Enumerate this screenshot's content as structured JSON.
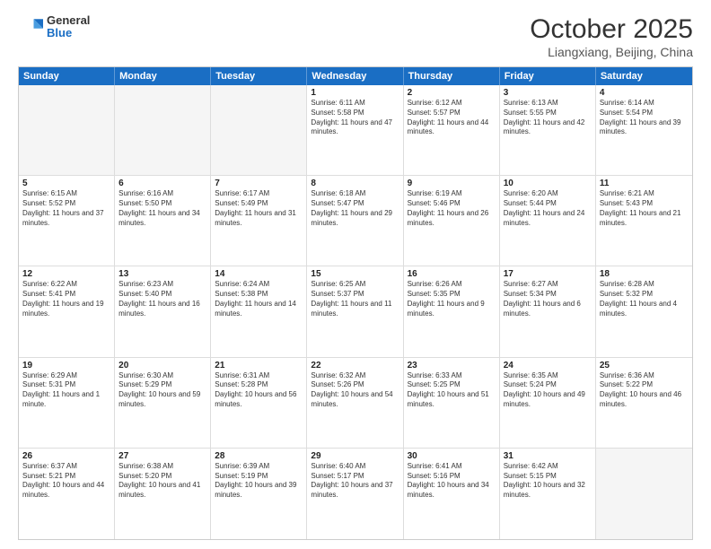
{
  "header": {
    "logo_general": "General",
    "logo_blue": "Blue",
    "month_title": "October 2025",
    "location": "Liangxiang, Beijing, China"
  },
  "days": [
    "Sunday",
    "Monday",
    "Tuesday",
    "Wednesday",
    "Thursday",
    "Friday",
    "Saturday"
  ],
  "rows": [
    [
      {
        "day": "",
        "empty": true
      },
      {
        "day": "",
        "empty": true
      },
      {
        "day": "",
        "empty": true
      },
      {
        "day": "1",
        "sunrise": "6:11 AM",
        "sunset": "5:58 PM",
        "daylight": "11 hours and 47 minutes."
      },
      {
        "day": "2",
        "sunrise": "6:12 AM",
        "sunset": "5:57 PM",
        "daylight": "11 hours and 44 minutes."
      },
      {
        "day": "3",
        "sunrise": "6:13 AM",
        "sunset": "5:55 PM",
        "daylight": "11 hours and 42 minutes."
      },
      {
        "day": "4",
        "sunrise": "6:14 AM",
        "sunset": "5:54 PM",
        "daylight": "11 hours and 39 minutes."
      }
    ],
    [
      {
        "day": "5",
        "sunrise": "6:15 AM",
        "sunset": "5:52 PM",
        "daylight": "11 hours and 37 minutes."
      },
      {
        "day": "6",
        "sunrise": "6:16 AM",
        "sunset": "5:50 PM",
        "daylight": "11 hours and 34 minutes."
      },
      {
        "day": "7",
        "sunrise": "6:17 AM",
        "sunset": "5:49 PM",
        "daylight": "11 hours and 31 minutes."
      },
      {
        "day": "8",
        "sunrise": "6:18 AM",
        "sunset": "5:47 PM",
        "daylight": "11 hours and 29 minutes."
      },
      {
        "day": "9",
        "sunrise": "6:19 AM",
        "sunset": "5:46 PM",
        "daylight": "11 hours and 26 minutes."
      },
      {
        "day": "10",
        "sunrise": "6:20 AM",
        "sunset": "5:44 PM",
        "daylight": "11 hours and 24 minutes."
      },
      {
        "day": "11",
        "sunrise": "6:21 AM",
        "sunset": "5:43 PM",
        "daylight": "11 hours and 21 minutes."
      }
    ],
    [
      {
        "day": "12",
        "sunrise": "6:22 AM",
        "sunset": "5:41 PM",
        "daylight": "11 hours and 19 minutes."
      },
      {
        "day": "13",
        "sunrise": "6:23 AM",
        "sunset": "5:40 PM",
        "daylight": "11 hours and 16 minutes."
      },
      {
        "day": "14",
        "sunrise": "6:24 AM",
        "sunset": "5:38 PM",
        "daylight": "11 hours and 14 minutes."
      },
      {
        "day": "15",
        "sunrise": "6:25 AM",
        "sunset": "5:37 PM",
        "daylight": "11 hours and 11 minutes."
      },
      {
        "day": "16",
        "sunrise": "6:26 AM",
        "sunset": "5:35 PM",
        "daylight": "11 hours and 9 minutes."
      },
      {
        "day": "17",
        "sunrise": "6:27 AM",
        "sunset": "5:34 PM",
        "daylight": "11 hours and 6 minutes."
      },
      {
        "day": "18",
        "sunrise": "6:28 AM",
        "sunset": "5:32 PM",
        "daylight": "11 hours and 4 minutes."
      }
    ],
    [
      {
        "day": "19",
        "sunrise": "6:29 AM",
        "sunset": "5:31 PM",
        "daylight": "11 hours and 1 minute."
      },
      {
        "day": "20",
        "sunrise": "6:30 AM",
        "sunset": "5:29 PM",
        "daylight": "10 hours and 59 minutes."
      },
      {
        "day": "21",
        "sunrise": "6:31 AM",
        "sunset": "5:28 PM",
        "daylight": "10 hours and 56 minutes."
      },
      {
        "day": "22",
        "sunrise": "6:32 AM",
        "sunset": "5:26 PM",
        "daylight": "10 hours and 54 minutes."
      },
      {
        "day": "23",
        "sunrise": "6:33 AM",
        "sunset": "5:25 PM",
        "daylight": "10 hours and 51 minutes."
      },
      {
        "day": "24",
        "sunrise": "6:35 AM",
        "sunset": "5:24 PM",
        "daylight": "10 hours and 49 minutes."
      },
      {
        "day": "25",
        "sunrise": "6:36 AM",
        "sunset": "5:22 PM",
        "daylight": "10 hours and 46 minutes."
      }
    ],
    [
      {
        "day": "26",
        "sunrise": "6:37 AM",
        "sunset": "5:21 PM",
        "daylight": "10 hours and 44 minutes."
      },
      {
        "day": "27",
        "sunrise": "6:38 AM",
        "sunset": "5:20 PM",
        "daylight": "10 hours and 41 minutes."
      },
      {
        "day": "28",
        "sunrise": "6:39 AM",
        "sunset": "5:19 PM",
        "daylight": "10 hours and 39 minutes."
      },
      {
        "day": "29",
        "sunrise": "6:40 AM",
        "sunset": "5:17 PM",
        "daylight": "10 hours and 37 minutes."
      },
      {
        "day": "30",
        "sunrise": "6:41 AM",
        "sunset": "5:16 PM",
        "daylight": "10 hours and 34 minutes."
      },
      {
        "day": "31",
        "sunrise": "6:42 AM",
        "sunset": "5:15 PM",
        "daylight": "10 hours and 32 minutes."
      },
      {
        "day": "",
        "empty": true
      }
    ]
  ]
}
